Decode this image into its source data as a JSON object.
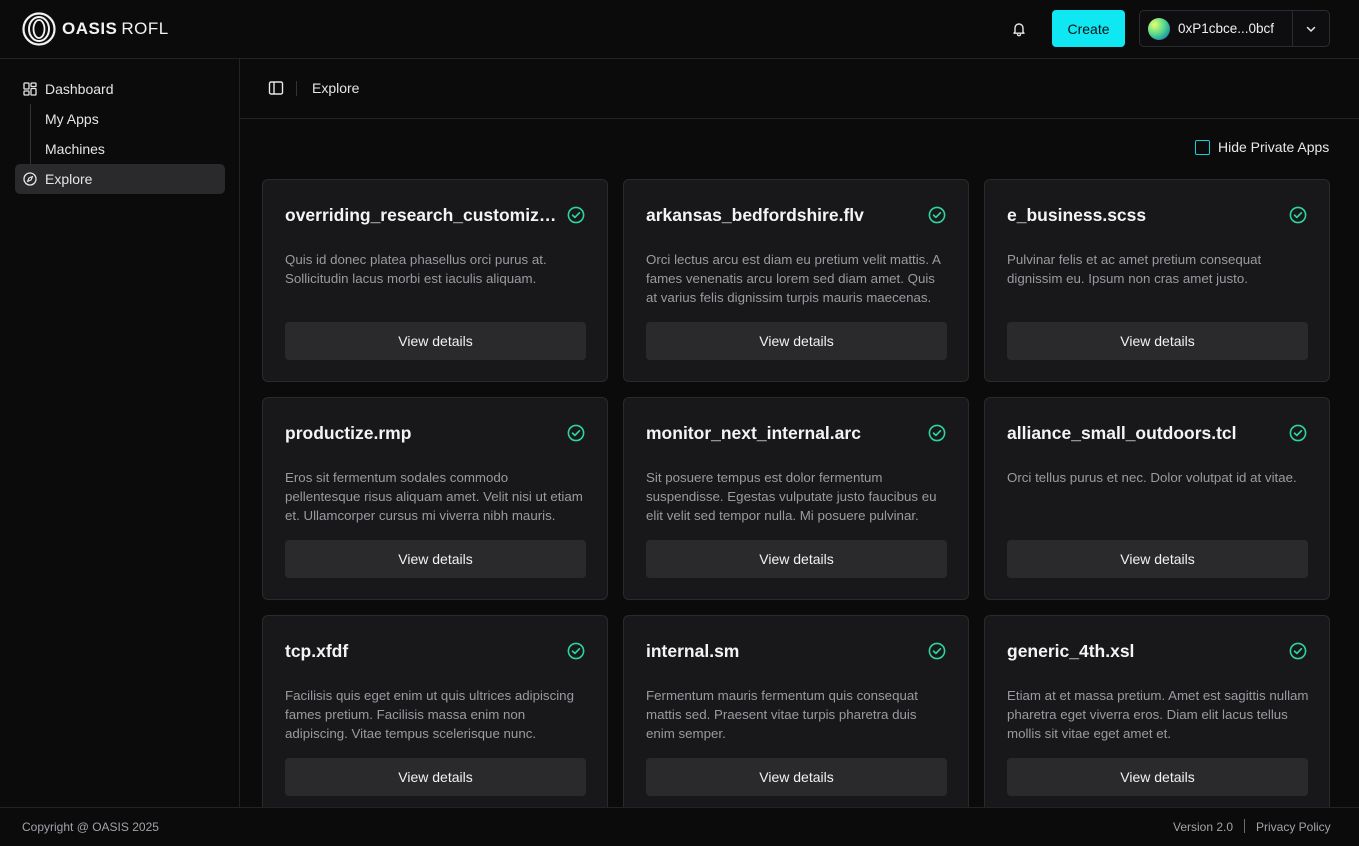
{
  "header": {
    "brand": "OASIS",
    "product": "ROFL",
    "create_label": "Create",
    "wallet_address": "0xP1cbce...0bcf",
    "icons": {
      "notifications": "bell-icon",
      "dropdown": "chevron-down-icon"
    },
    "accent_color": "#0fe7f3"
  },
  "sidebar": {
    "items": [
      {
        "label": "Dashboard",
        "icon": "dashboard-icon"
      },
      {
        "label": "My Apps"
      },
      {
        "label": "Machines"
      },
      {
        "label": "Explore",
        "icon": "compass-icon",
        "active": true
      }
    ]
  },
  "breadcrumb": {
    "current": "Explore"
  },
  "filters": {
    "hide_private_label": "Hide Private Apps",
    "hide_private_checked": false
  },
  "cards": [
    {
      "title": "overriding_research_customiza...",
      "description": "Quis id donec platea phasellus orci purus at. Sollicitudin lacus morbi est iaculis aliquam.",
      "button": "View details"
    },
    {
      "title": "arkansas_bedfordshire.flv",
      "description": "Orci lectus arcu est diam eu pretium velit mattis. A fames venenatis arcu lorem sed diam amet. Quis at varius felis dignissim turpis mauris maecenas.",
      "button": "View details"
    },
    {
      "title": "e_business.scss",
      "description": "Pulvinar felis et ac amet pretium consequat dignissim eu. Ipsum non cras amet justo.",
      "button": "View details"
    },
    {
      "title": "productize.rmp",
      "description": "Eros sit fermentum sodales commodo pellentesque risus aliquam amet. Velit nisi ut etiam et. Ullamcorper cursus mi viverra nibh mauris.",
      "button": "View details"
    },
    {
      "title": "monitor_next_internal.arc",
      "description": "Sit posuere tempus est dolor fermentum suspendisse. Egestas vulputate justo faucibus eu elit velit sed tempor nulla. Mi posuere pulvinar.",
      "button": "View details"
    },
    {
      "title": "alliance_small_outdoors.tcl",
      "description": "Orci tellus purus et nec. Dolor volutpat id at vitae.",
      "button": "View details"
    },
    {
      "title": "tcp.xfdf",
      "description": "Facilisis quis eget enim ut quis ultrices adipiscing fames pretium. Facilisis massa enim non adipiscing. Vitae tempus scelerisque nunc.",
      "button": "View details"
    },
    {
      "title": "internal.sm",
      "description": "Fermentum mauris fermentum quis consequat mattis sed. Praesent vitae turpis pharetra duis enim semper.",
      "button": "View details"
    },
    {
      "title": "generic_4th.xsl",
      "description": "Etiam at et massa pretium. Amet est sagittis nullam pharetra eget viverra eros. Diam elit lacus tellus mollis sit vitae eget amet et.",
      "button": "View details"
    }
  ],
  "status_color": "#2fd39b",
  "footer": {
    "copyright": "Copyright @ OASIS 2025",
    "version": "Version 2.0",
    "privacy": "Privacy Policy"
  }
}
